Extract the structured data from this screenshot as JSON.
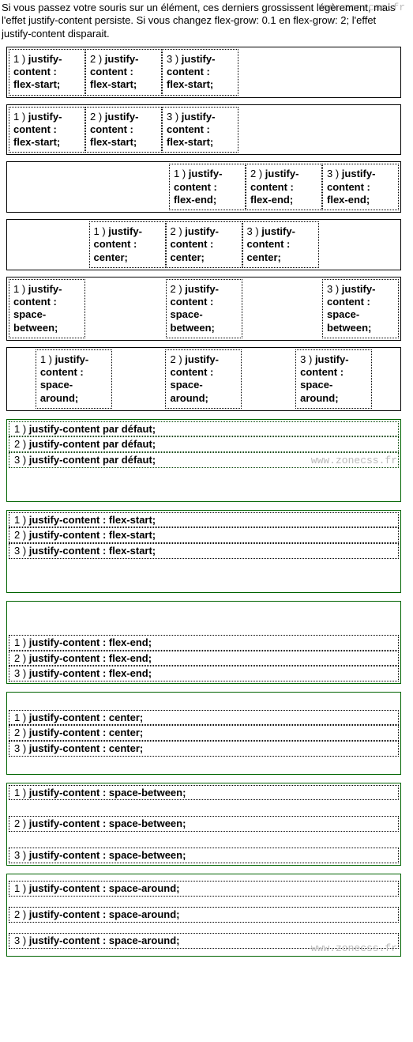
{
  "intro": "Si vous passez votre souris sur un élément, ces derniers grossissent légèrement, mais l'effet justify-content persiste. Si vous changez flex-grow: 0.1 en flex-grow: 2; l'effet justify-content disparait.",
  "watermark": "www.zonecss.fr",
  "rowDemos": [
    {
      "id": "row-default",
      "cells": [
        "1 ) justify-content : flex-start;",
        "2 ) justify-content : flex-start;",
        "3 ) justify-content : flex-start;"
      ]
    },
    {
      "id": "row-flex-start",
      "cells": [
        "1 ) justify-content : flex-start;",
        "2 ) justify-content : flex-start;",
        "3 ) justify-content : flex-start;"
      ]
    },
    {
      "id": "row-flex-end",
      "cells": [
        "1 ) justify-content : flex-end;",
        "2 ) justify-content : flex-end;",
        "3 ) justify-content : flex-end;"
      ]
    },
    {
      "id": "row-center",
      "cells": [
        "1 ) justify-content : center;",
        "2 ) justify-content : center;",
        "3 ) justify-content : center;"
      ]
    },
    {
      "id": "row-space-between",
      "cells": [
        "1 ) justify-content : space-between;",
        "2 ) justify-content : space-between;",
        "3 ) justify-content : space-between;"
      ]
    },
    {
      "id": "row-space-around",
      "cells": [
        "1 ) justify-content : space-around;",
        "2 ) justify-content : space-around;",
        "3 ) justify-content : space-around;"
      ]
    }
  ],
  "colDemos": [
    {
      "id": "col-default",
      "lines": [
        "1 ) justify-content par défaut;",
        "2 ) justify-content par défaut;",
        "3 ) justify-content par défaut;"
      ]
    },
    {
      "id": "col-flex-start",
      "lines": [
        "1 ) justify-content : flex-start;",
        "2 ) justify-content : flex-start;",
        "3 ) justify-content : flex-start;"
      ]
    },
    {
      "id": "col-flex-end",
      "lines": [
        "1 ) justify-content : flex-end;",
        "2 ) justify-content : flex-end;",
        "3 ) justify-content : flex-end;"
      ]
    },
    {
      "id": "col-center",
      "lines": [
        "1 ) justify-content : center;",
        "2 ) justify-content : center;",
        "3 ) justify-content : center;"
      ]
    },
    {
      "id": "col-space-between",
      "lines": [
        "1 ) justify-content : space-between;",
        "2 ) justify-content : space-between;",
        "3 ) justify-content : space-between;"
      ]
    },
    {
      "id": "col-space-around",
      "lines": [
        "1 ) justify-content : space-around;",
        "2 ) justify-content : space-around;",
        "3 ) justify-content : space-around;"
      ]
    }
  ]
}
